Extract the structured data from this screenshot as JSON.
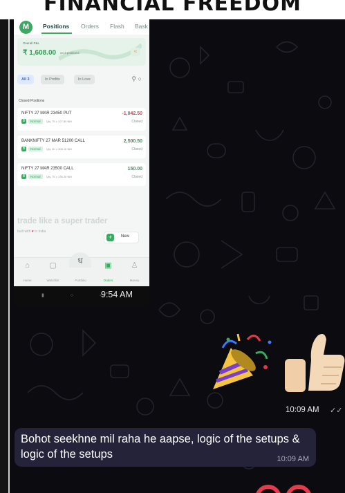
{
  "banner": {
    "title": "FINANCIAL FREEDOM"
  },
  "screenshot": {
    "logo": "M",
    "tabs": [
      "Positions",
      "Orders",
      "Flash",
      "Bask"
    ],
    "active_tab": "Positions",
    "pnl": {
      "label": "Overall P&L",
      "value": "₹ 1,608.00",
      "sub": "on 3 positions",
      "share_icon": "share-icon"
    },
    "filters": [
      {
        "label": "All 3",
        "active": true
      },
      {
        "label": "In Profits",
        "active": false
      },
      {
        "label": "In Loss",
        "active": false
      }
    ],
    "section_label": "Closed Positions",
    "positions": [
      {
        "name": "NIFTY 27 MAR 23450 PUT",
        "pnl": "-1,042.50",
        "badge": "B",
        "type": "Normal",
        "qty": "Qty. 75 × 127.80 NM",
        "status": "Closed"
      },
      {
        "name": "BANKNIFTY 27 MAR 51200 CALL",
        "pnl": "2,500.50",
        "badge": "B",
        "type": "Normal",
        "qty": "Qty. 30 × 308.10 NM",
        "status": "Closed"
      },
      {
        "name": "NIFTY 27 MAR 23500 CALL",
        "pnl": "150.00",
        "badge": "B",
        "type": "Normal",
        "qty": "Qty. 75 × 136.30 NM",
        "status": "Closed"
      }
    ],
    "tagline": "trade like a super trader",
    "built": {
      "prefix": "built with",
      "heart": "♥",
      "suffix": "in India"
    },
    "new_button": {
      "plus": "+",
      "label": "New"
    },
    "nav": [
      {
        "label": "Home",
        "icon": "⌂",
        "active": false
      },
      {
        "label": "Watchlist",
        "icon": "▢",
        "active": false
      },
      {
        "label": "Portfolio",
        "icon": "▤",
        "active": false
      },
      {
        "label": "Orders",
        "icon": "▣",
        "active": true
      },
      {
        "label": "Money",
        "icon": "♙",
        "active": false
      }
    ],
    "nav_center": "ध",
    "time": "9:54 AM"
  },
  "sticker": {
    "time": "10:09 AM",
    "ticks": "✓✓"
  },
  "message": {
    "text": "Bohot seekhne mil raha he aapse, logic of the setups & logic of the setups",
    "time": "10:09 AM"
  },
  "colors": {
    "bubble": "#25233a",
    "accent_green": "#3da861",
    "loss_red": "#e23b4b",
    "chat_bg": "#0b0b10"
  }
}
